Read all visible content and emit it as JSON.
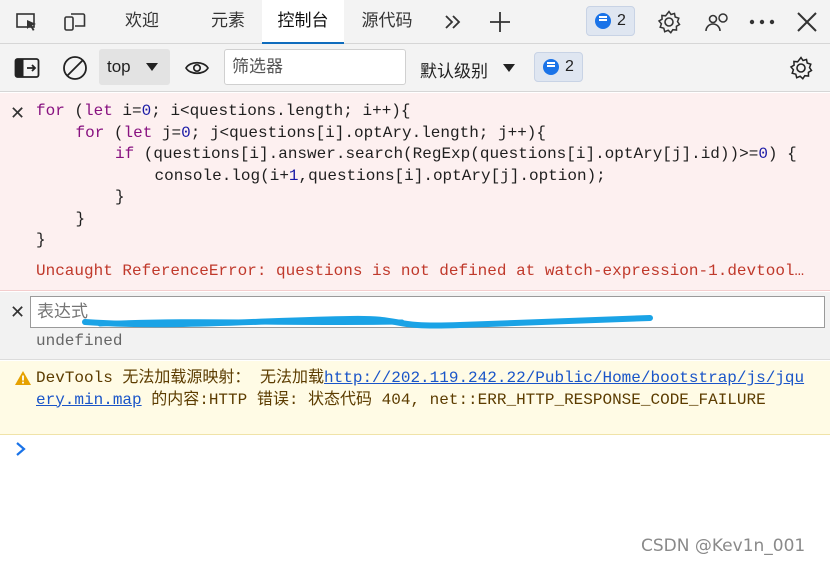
{
  "tabs": [
    {
      "label": "欢迎",
      "active": false
    },
    {
      "label": "元素",
      "active": false
    },
    {
      "label": "控制台",
      "active": true
    },
    {
      "label": "源代码",
      "active": false
    }
  ],
  "tabbar": {
    "more_tabs_icon": "chevron-double-right-icon",
    "add_tab_icon": "plus-icon",
    "issues_count": "2"
  },
  "toolbar": {
    "context_value": "top",
    "filter_placeholder": "筛选器",
    "level_label": "默认级别",
    "issues_count": "2"
  },
  "watch": {
    "expression_code": [
      {
        "indent": 0,
        "parts": [
          {
            "t": "kw",
            "v": "for"
          },
          {
            "t": "txt",
            "v": " ("
          },
          {
            "t": "kw",
            "v": "let"
          },
          {
            "t": "txt",
            "v": " i="
          },
          {
            "t": "num",
            "v": "0"
          },
          {
            "t": "txt",
            "v": "; i<questions.length; i++){"
          }
        ]
      },
      {
        "indent": 1,
        "parts": [
          {
            "t": "kw",
            "v": "for"
          },
          {
            "t": "txt",
            "v": " ("
          },
          {
            "t": "kw",
            "v": "let"
          },
          {
            "t": "txt",
            "v": " j="
          },
          {
            "t": "num",
            "v": "0"
          },
          {
            "t": "txt",
            "v": "; j<questions[i].optAry.length; j++){"
          }
        ]
      },
      {
        "indent": 2,
        "parts": [
          {
            "t": "kw",
            "v": "if"
          },
          {
            "t": "txt",
            "v": " (questions[i].answer.search(RegExp(questions[i].optAry[j].id))>="
          },
          {
            "t": "num",
            "v": "0"
          },
          {
            "t": "txt",
            "v": ") {"
          }
        ]
      },
      {
        "indent": 3,
        "parts": [
          {
            "t": "txt",
            "v": "console.log(i+"
          },
          {
            "t": "num",
            "v": "1"
          },
          {
            "t": "txt",
            "v": ",questions[i].optAry[j].option);"
          }
        ]
      },
      {
        "indent": 2,
        "parts": [
          {
            "t": "txt",
            "v": "}"
          }
        ]
      },
      {
        "indent": 1,
        "parts": [
          {
            "t": "txt",
            "v": "}"
          }
        ]
      },
      {
        "indent": 0,
        "parts": [
          {
            "t": "txt",
            "v": "}"
          }
        ]
      }
    ],
    "error_message": "Uncaught ReferenceError: questions is not defined at watch-expression-1.devtool…",
    "expression_placeholder": "表达式",
    "result": "undefined"
  },
  "warning": {
    "prefix": "DevTools 无法加载源映射： 无法加载",
    "link": "http://202.119.242.22/Public/Home/bootstrap/js/jquery.min.map",
    "suffix": " 的内容:HTTP 错误: 状态代码 404, net::ERR_HTTP_RESPONSE_CODE_FAILURE"
  },
  "watermark": "CSDN @Kev1n_001",
  "colors": {
    "accent": "#0f6cbd",
    "error_bg": "#fdf0f0",
    "warning_bg": "#fffbe5",
    "error_text": "#c0392b"
  }
}
